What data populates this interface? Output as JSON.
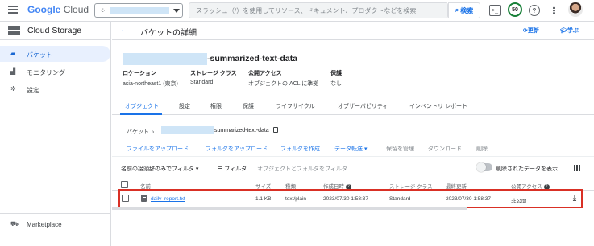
{
  "topbar": {
    "brand_google": "Google",
    "brand_cloud": "Cloud",
    "search_placeholder": "スラッシュ（/）を使用してリソース、ドキュメント、プロダクトなどを検索",
    "search_button": "検索",
    "badge_count": "50",
    "accent": "#1a73e8"
  },
  "sidebar": {
    "title": "Cloud Storage",
    "items": [
      {
        "label": "バケット",
        "icon": "bucket-icon"
      },
      {
        "label": "モニタリング",
        "icon": "chart-icon"
      },
      {
        "label": "設定",
        "icon": "gear-icon"
      }
    ],
    "footer": "Marketplace"
  },
  "header": {
    "title": "バケットの詳細",
    "refresh": "更新",
    "learn": "学ぶ"
  },
  "bucket": {
    "name_suffix": "-summarized-text-data",
    "meta": [
      {
        "label": "ロケーション",
        "value": "asia-northeast1 (東京)"
      },
      {
        "label": "ストレージ クラス",
        "value": "Standard"
      },
      {
        "label": "公開アクセス",
        "value": "オブジェクトの ACL に準拠"
      },
      {
        "label": "保護",
        "value": "なし"
      }
    ]
  },
  "tabs": [
    "オブジェクト",
    "設定",
    "権限",
    "保護",
    "ライフサイクル",
    "オブザーバビリティ",
    "インベントリ レポート"
  ],
  "breadcrumb": {
    "root": "バケット",
    "name": "summarized-text-data"
  },
  "actions": [
    "ファイルをアップロード",
    "フォルダをアップロード",
    "フォルダを作成",
    "データ転送",
    "保留を管理",
    "ダウンロード",
    "削除"
  ],
  "filter": {
    "prefix": "名前の接頭辞のみでフィルタ",
    "label": "フィルタ",
    "placeholder": "オブジェクトとフォルダをフィルタ",
    "show_deleted": "削除されたデータを表示"
  },
  "table": {
    "columns": [
      "名前",
      "サイズ",
      "種類",
      "作成日時",
      "ストレージ クラス",
      "最終更新",
      "公開アクセス"
    ],
    "rows": [
      {
        "name": "daily_report.txt",
        "size": "1.1 KB",
        "type": "text/plain",
        "created": "2023/07/30 1:58:37",
        "class": "Standard",
        "updated": "2023/07/30 1:58:37",
        "public": "非公開"
      }
    ]
  }
}
